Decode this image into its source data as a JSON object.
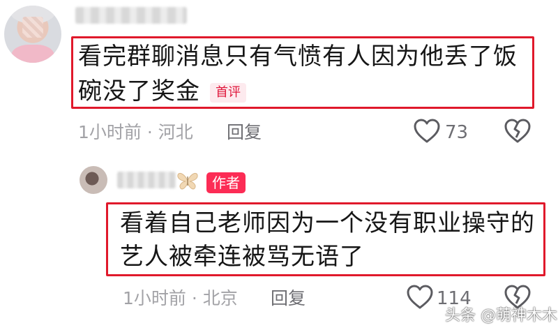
{
  "comment1": {
    "text": "看完群聊消息只有气愤有人因为他丢了饭碗没了奖金",
    "tag": "首评",
    "meta": "1小时前 · 河北",
    "reply_label": "回复",
    "like_count": "73"
  },
  "comment2": {
    "author_tag": "作者",
    "text": "看着自己老师因为一个没有职业操守的艺人被牵连被骂无语了",
    "meta": "1小时前 · 北京",
    "reply_label": "回复",
    "like_count": "114"
  },
  "watermark": "头条 @萌神木木",
  "colors": {
    "highlight_box": "#e0192b",
    "author_tag_bg": "#fc2c55",
    "first_tag_text": "#e0193d",
    "meta_text": "#a2a2a6"
  },
  "icons": [
    "heart-icon",
    "broken-heart-icon",
    "butterfly-icon"
  ]
}
